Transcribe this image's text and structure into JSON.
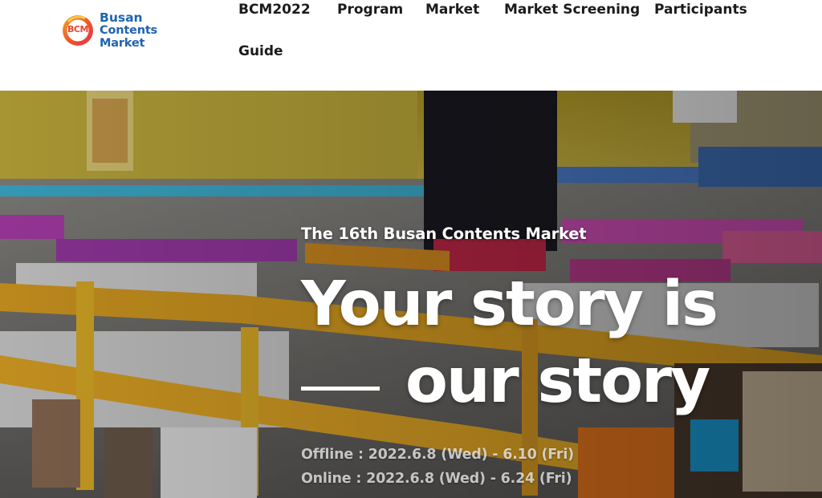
{
  "logo": {
    "mark_text": "BCM",
    "line1": "Busan",
    "line2": "Contents Market",
    "brand_color": "#1e63b0",
    "mark_colors": [
      "#e8442d",
      "#f5a623",
      "#ffffff"
    ]
  },
  "nav": {
    "items": [
      {
        "label": "BCM2022"
      },
      {
        "label": "Program"
      },
      {
        "label": "Market"
      },
      {
        "label": "Market Screening"
      },
      {
        "label": "Participants"
      },
      {
        "label": "Guide"
      }
    ]
  },
  "hero": {
    "edition": "The 16th Busan Contents Market",
    "headline_line1": "Your story is",
    "headline_line2": "our story",
    "offline_label": "Offline",
    "offline_dates": "2022.6.8 (Wed) - 6.10 (Fri)",
    "online_label": "Online",
    "online_dates": "2022.6.8 (Wed) - 6.24 (Fri)",
    "separator": ":",
    "background_image": "exhibition-hall-photo"
  }
}
